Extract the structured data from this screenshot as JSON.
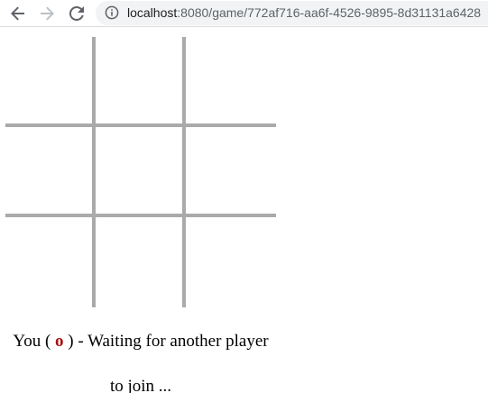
{
  "browser": {
    "url_host": "localhost",
    "url_path": ":8080/game/772af716-aa6f-4526-9895-8d31131a6428",
    "icons": {
      "back": "back-arrow-icon",
      "forward": "forward-arrow-icon",
      "reload": "reload-icon",
      "info": "info-icon"
    }
  },
  "board": {
    "rows": 3,
    "cols": 3,
    "cells": [
      "",
      "",
      "",
      "",
      "",
      "",
      "",
      "",
      ""
    ],
    "line_color": "#aaaaaa"
  },
  "status": {
    "prefix": "You (",
    "symbol": "o",
    "suffix_line1": ") - Waiting for another player",
    "line2": "to join ...",
    "symbol_color": "#a90f0f"
  }
}
